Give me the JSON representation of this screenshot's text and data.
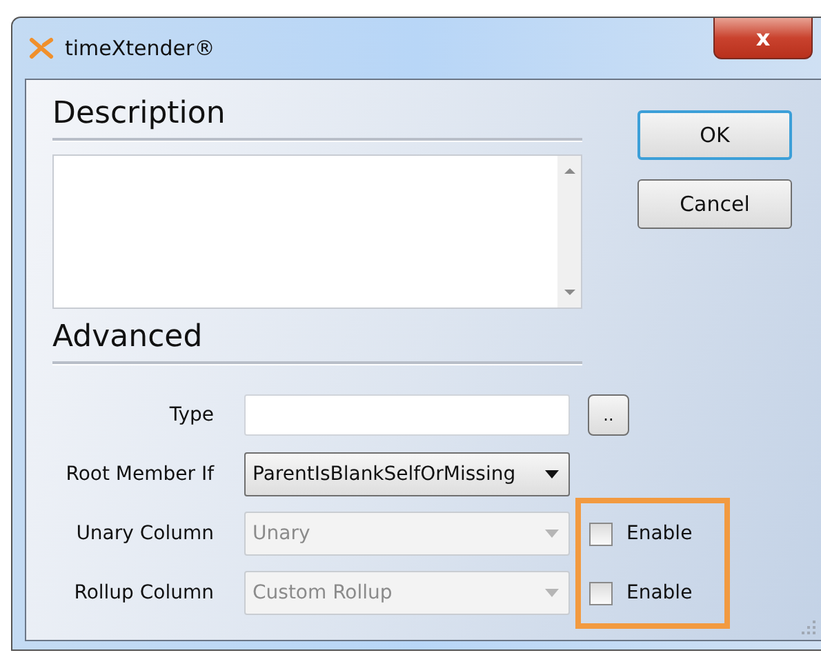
{
  "window": {
    "title": "timeXtender®",
    "close": "x"
  },
  "description": {
    "heading": "Description"
  },
  "advanced": {
    "heading": "Advanced",
    "fields": [
      {
        "kind": "text",
        "label": "Type",
        "button": ".."
      },
      {
        "kind": "dropdown",
        "label": "Root Member If",
        "value": "ParentIsBlankSelfOrMissing",
        "disabled": false
      },
      {
        "kind": "dropdown",
        "label": "Unary Column",
        "value": "Unary",
        "disabled": true,
        "checkbox": {
          "label": "Enable",
          "checked": false,
          "highlighted": true
        }
      },
      {
        "kind": "dropdown",
        "label": "Rollup Column",
        "value": "Custom Rollup",
        "disabled": true,
        "checkbox": {
          "label": "Enable",
          "checked": false,
          "highlighted": true
        }
      }
    ]
  },
  "buttons": [
    {
      "label": "OK",
      "default": true
    },
    {
      "label": "Cancel",
      "default": false
    }
  ]
}
